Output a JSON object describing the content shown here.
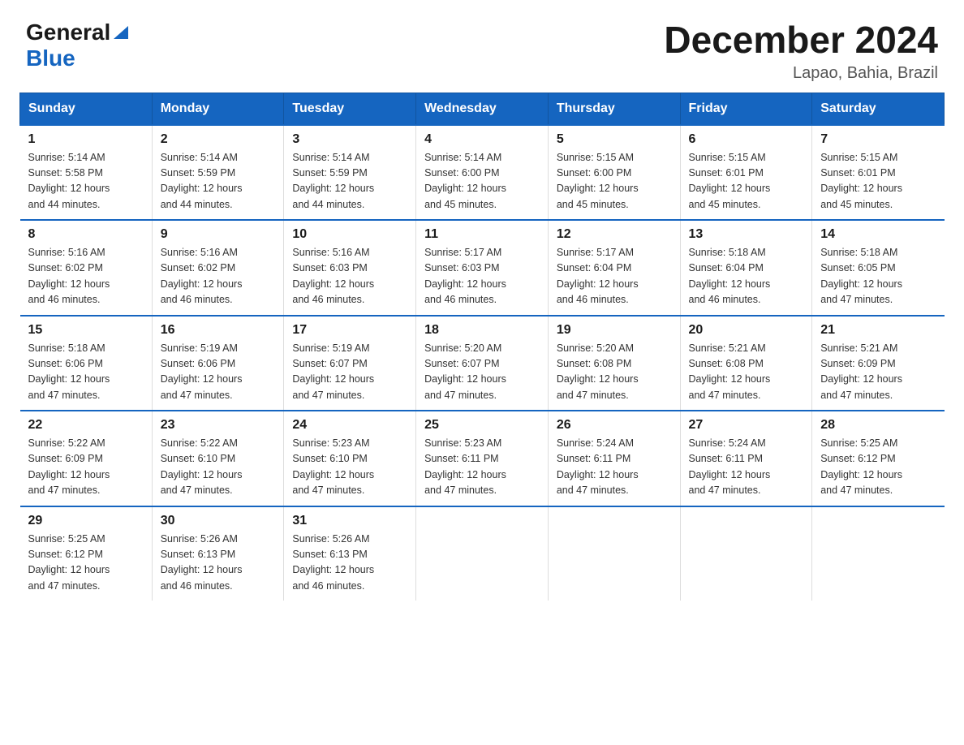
{
  "logo": {
    "general": "General",
    "triangle": "▶",
    "blue": "Blue"
  },
  "title": "December 2024",
  "subtitle": "Lapao, Bahia, Brazil",
  "days_of_week": [
    "Sunday",
    "Monday",
    "Tuesday",
    "Wednesday",
    "Thursday",
    "Friday",
    "Saturday"
  ],
  "weeks": [
    [
      {
        "day": "1",
        "sunrise": "5:14 AM",
        "sunset": "5:58 PM",
        "daylight": "12 hours and 44 minutes."
      },
      {
        "day": "2",
        "sunrise": "5:14 AM",
        "sunset": "5:59 PM",
        "daylight": "12 hours and 44 minutes."
      },
      {
        "day": "3",
        "sunrise": "5:14 AM",
        "sunset": "5:59 PM",
        "daylight": "12 hours and 44 minutes."
      },
      {
        "day": "4",
        "sunrise": "5:14 AM",
        "sunset": "6:00 PM",
        "daylight": "12 hours and 45 minutes."
      },
      {
        "day": "5",
        "sunrise": "5:15 AM",
        "sunset": "6:00 PM",
        "daylight": "12 hours and 45 minutes."
      },
      {
        "day": "6",
        "sunrise": "5:15 AM",
        "sunset": "6:01 PM",
        "daylight": "12 hours and 45 minutes."
      },
      {
        "day": "7",
        "sunrise": "5:15 AM",
        "sunset": "6:01 PM",
        "daylight": "12 hours and 45 minutes."
      }
    ],
    [
      {
        "day": "8",
        "sunrise": "5:16 AM",
        "sunset": "6:02 PM",
        "daylight": "12 hours and 46 minutes."
      },
      {
        "day": "9",
        "sunrise": "5:16 AM",
        "sunset": "6:02 PM",
        "daylight": "12 hours and 46 minutes."
      },
      {
        "day": "10",
        "sunrise": "5:16 AM",
        "sunset": "6:03 PM",
        "daylight": "12 hours and 46 minutes."
      },
      {
        "day": "11",
        "sunrise": "5:17 AM",
        "sunset": "6:03 PM",
        "daylight": "12 hours and 46 minutes."
      },
      {
        "day": "12",
        "sunrise": "5:17 AM",
        "sunset": "6:04 PM",
        "daylight": "12 hours and 46 minutes."
      },
      {
        "day": "13",
        "sunrise": "5:18 AM",
        "sunset": "6:04 PM",
        "daylight": "12 hours and 46 minutes."
      },
      {
        "day": "14",
        "sunrise": "5:18 AM",
        "sunset": "6:05 PM",
        "daylight": "12 hours and 47 minutes."
      }
    ],
    [
      {
        "day": "15",
        "sunrise": "5:18 AM",
        "sunset": "6:06 PM",
        "daylight": "12 hours and 47 minutes."
      },
      {
        "day": "16",
        "sunrise": "5:19 AM",
        "sunset": "6:06 PM",
        "daylight": "12 hours and 47 minutes."
      },
      {
        "day": "17",
        "sunrise": "5:19 AM",
        "sunset": "6:07 PM",
        "daylight": "12 hours and 47 minutes."
      },
      {
        "day": "18",
        "sunrise": "5:20 AM",
        "sunset": "6:07 PM",
        "daylight": "12 hours and 47 minutes."
      },
      {
        "day": "19",
        "sunrise": "5:20 AM",
        "sunset": "6:08 PM",
        "daylight": "12 hours and 47 minutes."
      },
      {
        "day": "20",
        "sunrise": "5:21 AM",
        "sunset": "6:08 PM",
        "daylight": "12 hours and 47 minutes."
      },
      {
        "day": "21",
        "sunrise": "5:21 AM",
        "sunset": "6:09 PM",
        "daylight": "12 hours and 47 minutes."
      }
    ],
    [
      {
        "day": "22",
        "sunrise": "5:22 AM",
        "sunset": "6:09 PM",
        "daylight": "12 hours and 47 minutes."
      },
      {
        "day": "23",
        "sunrise": "5:22 AM",
        "sunset": "6:10 PM",
        "daylight": "12 hours and 47 minutes."
      },
      {
        "day": "24",
        "sunrise": "5:23 AM",
        "sunset": "6:10 PM",
        "daylight": "12 hours and 47 minutes."
      },
      {
        "day": "25",
        "sunrise": "5:23 AM",
        "sunset": "6:11 PM",
        "daylight": "12 hours and 47 minutes."
      },
      {
        "day": "26",
        "sunrise": "5:24 AM",
        "sunset": "6:11 PM",
        "daylight": "12 hours and 47 minutes."
      },
      {
        "day": "27",
        "sunrise": "5:24 AM",
        "sunset": "6:11 PM",
        "daylight": "12 hours and 47 minutes."
      },
      {
        "day": "28",
        "sunrise": "5:25 AM",
        "sunset": "6:12 PM",
        "daylight": "12 hours and 47 minutes."
      }
    ],
    [
      {
        "day": "29",
        "sunrise": "5:25 AM",
        "sunset": "6:12 PM",
        "daylight": "12 hours and 47 minutes."
      },
      {
        "day": "30",
        "sunrise": "5:26 AM",
        "sunset": "6:13 PM",
        "daylight": "12 hours and 46 minutes."
      },
      {
        "day": "31",
        "sunrise": "5:26 AM",
        "sunset": "6:13 PM",
        "daylight": "12 hours and 46 minutes."
      },
      null,
      null,
      null,
      null
    ]
  ],
  "sunrise_label": "Sunrise:",
  "sunset_label": "Sunset:",
  "daylight_label": "Daylight:"
}
